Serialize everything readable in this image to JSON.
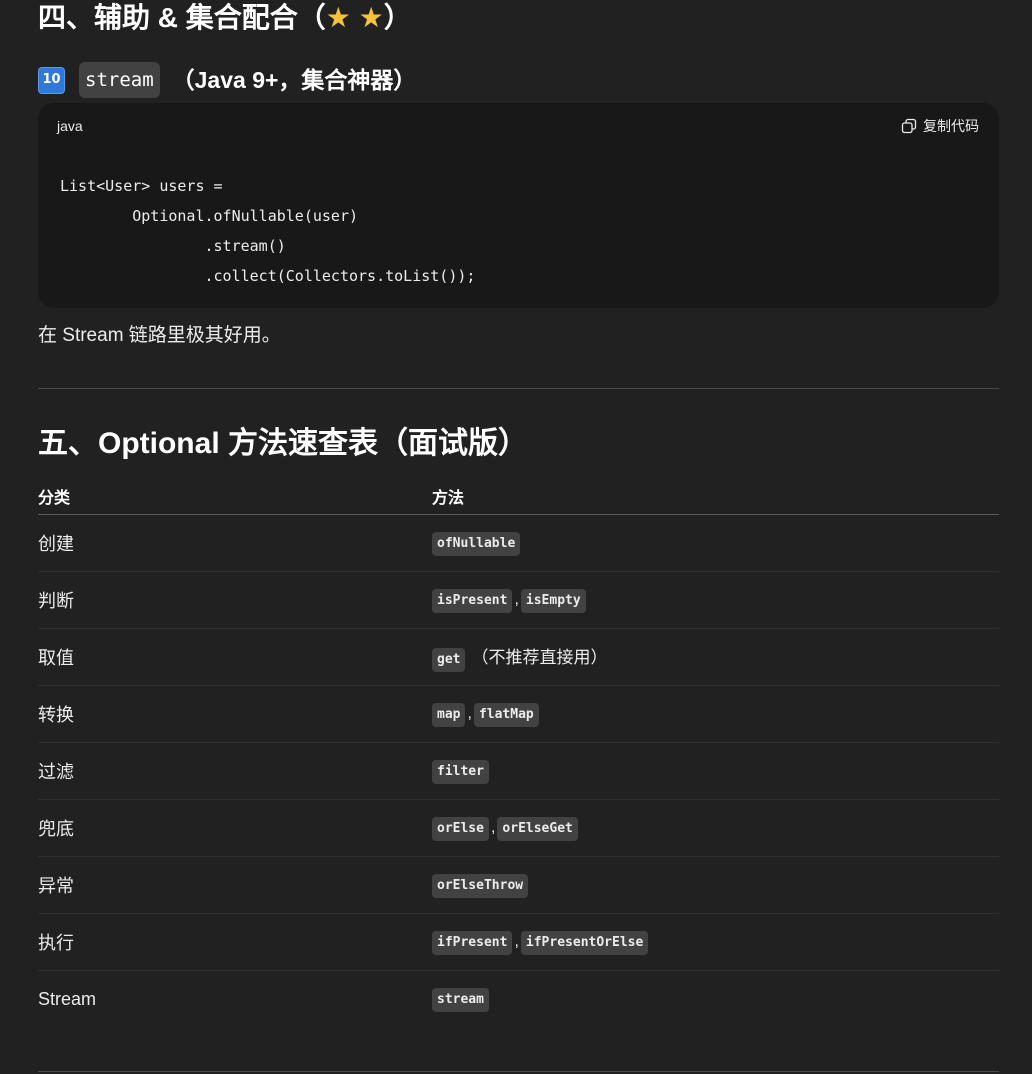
{
  "section4": {
    "title_prefix": "四、辅助 & 集合配合（",
    "stars": "★ ★",
    "title_suffix": "）"
  },
  "subsection": {
    "keycap": "10",
    "code": "stream",
    "title": "（Java 9+，集合神器）"
  },
  "codeblock": {
    "language": "java",
    "copy_label": "复制代码",
    "code": "List<User> users =\n        Optional.ofNullable(user)\n                .stream()\n                .collect(Collectors.toList());"
  },
  "note": "在 Stream 链路里极其好用。",
  "section5": {
    "title": "五、Optional 方法速查表（面试版）"
  },
  "table": {
    "headers": [
      "分类",
      "方法"
    ],
    "rows": [
      {
        "category": "创建",
        "methods": [
          "ofNullable"
        ],
        "remark": ""
      },
      {
        "category": "判断",
        "methods": [
          "isPresent",
          "isEmpty"
        ],
        "remark": ""
      },
      {
        "category": "取值",
        "methods": [
          "get"
        ],
        "remark": "（不推荐直接用）"
      },
      {
        "category": "转换",
        "methods": [
          "map",
          "flatMap"
        ],
        "remark": ""
      },
      {
        "category": "过滤",
        "methods": [
          "filter"
        ],
        "remark": ""
      },
      {
        "category": "兜底",
        "methods": [
          "orElse",
          "orElseGet"
        ],
        "remark": ""
      },
      {
        "category": "异常",
        "methods": [
          "orElseThrow"
        ],
        "remark": ""
      },
      {
        "category": "执行",
        "methods": [
          "ifPresent",
          "ifPresentOrElse"
        ],
        "remark": ""
      },
      {
        "category": "Stream",
        "methods": [
          "stream"
        ],
        "remark": ""
      }
    ],
    "separator": ","
  },
  "colors": {
    "background": "#212121",
    "code_background": "#181818",
    "inline_code_background": "#424242",
    "star": "#f5c33b",
    "keycap": "#2f7ad8"
  }
}
